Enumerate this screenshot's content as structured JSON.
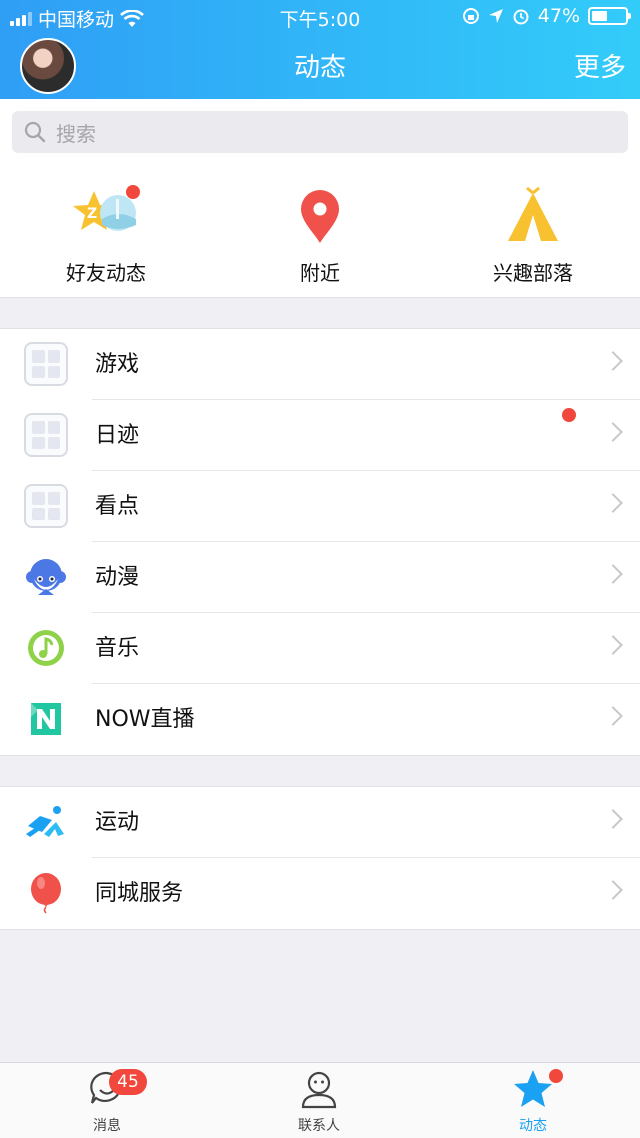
{
  "status_bar": {
    "carrier": "中国移动",
    "time": "下午5:00",
    "battery_percent": "47%",
    "battery_level": 0.47,
    "icons": [
      "signal-icon",
      "wifi-icon",
      "rotation-lock-icon",
      "location-icon",
      "alarm-icon",
      "battery-icon"
    ]
  },
  "header": {
    "title": "动态",
    "more_label": "更多",
    "avatar_icon": "user-avatar"
  },
  "search": {
    "placeholder": "搜索",
    "icon": "search-icon"
  },
  "quick_actions": [
    {
      "label": "好友动态",
      "icon": "friends-feed-icon",
      "has_dot": true
    },
    {
      "label": "附近",
      "icon": "location-pin-icon",
      "has_dot": false
    },
    {
      "label": "兴趣部落",
      "icon": "tent-icon",
      "has_dot": false
    }
  ],
  "list_group_1": [
    {
      "label": "游戏",
      "icon": "game-placeholder-icon"
    },
    {
      "label": "日迹",
      "icon": "diary-placeholder-icon",
      "has_dot": true
    },
    {
      "label": "看点",
      "icon": "kandian-placeholder-icon"
    },
    {
      "label": "动漫",
      "icon": "anime-icon"
    },
    {
      "label": "音乐",
      "icon": "music-icon"
    },
    {
      "label": "NOW直播",
      "icon": "now-live-icon"
    }
  ],
  "list_group_2": [
    {
      "label": "运动",
      "icon": "sport-icon"
    },
    {
      "label": "同城服务",
      "icon": "balloon-icon"
    }
  ],
  "tab_bar": [
    {
      "label": "消息",
      "icon": "message-icon",
      "badge": "45"
    },
    {
      "label": "联系人",
      "icon": "contacts-icon"
    },
    {
      "label": "动态",
      "icon": "star-icon",
      "active": true,
      "has_dot": true
    }
  ],
  "colors": {
    "accent": "#1aa1f2",
    "header_start": "#2f9ef5",
    "header_end": "#33ccf9",
    "badge": "#f2473c"
  }
}
